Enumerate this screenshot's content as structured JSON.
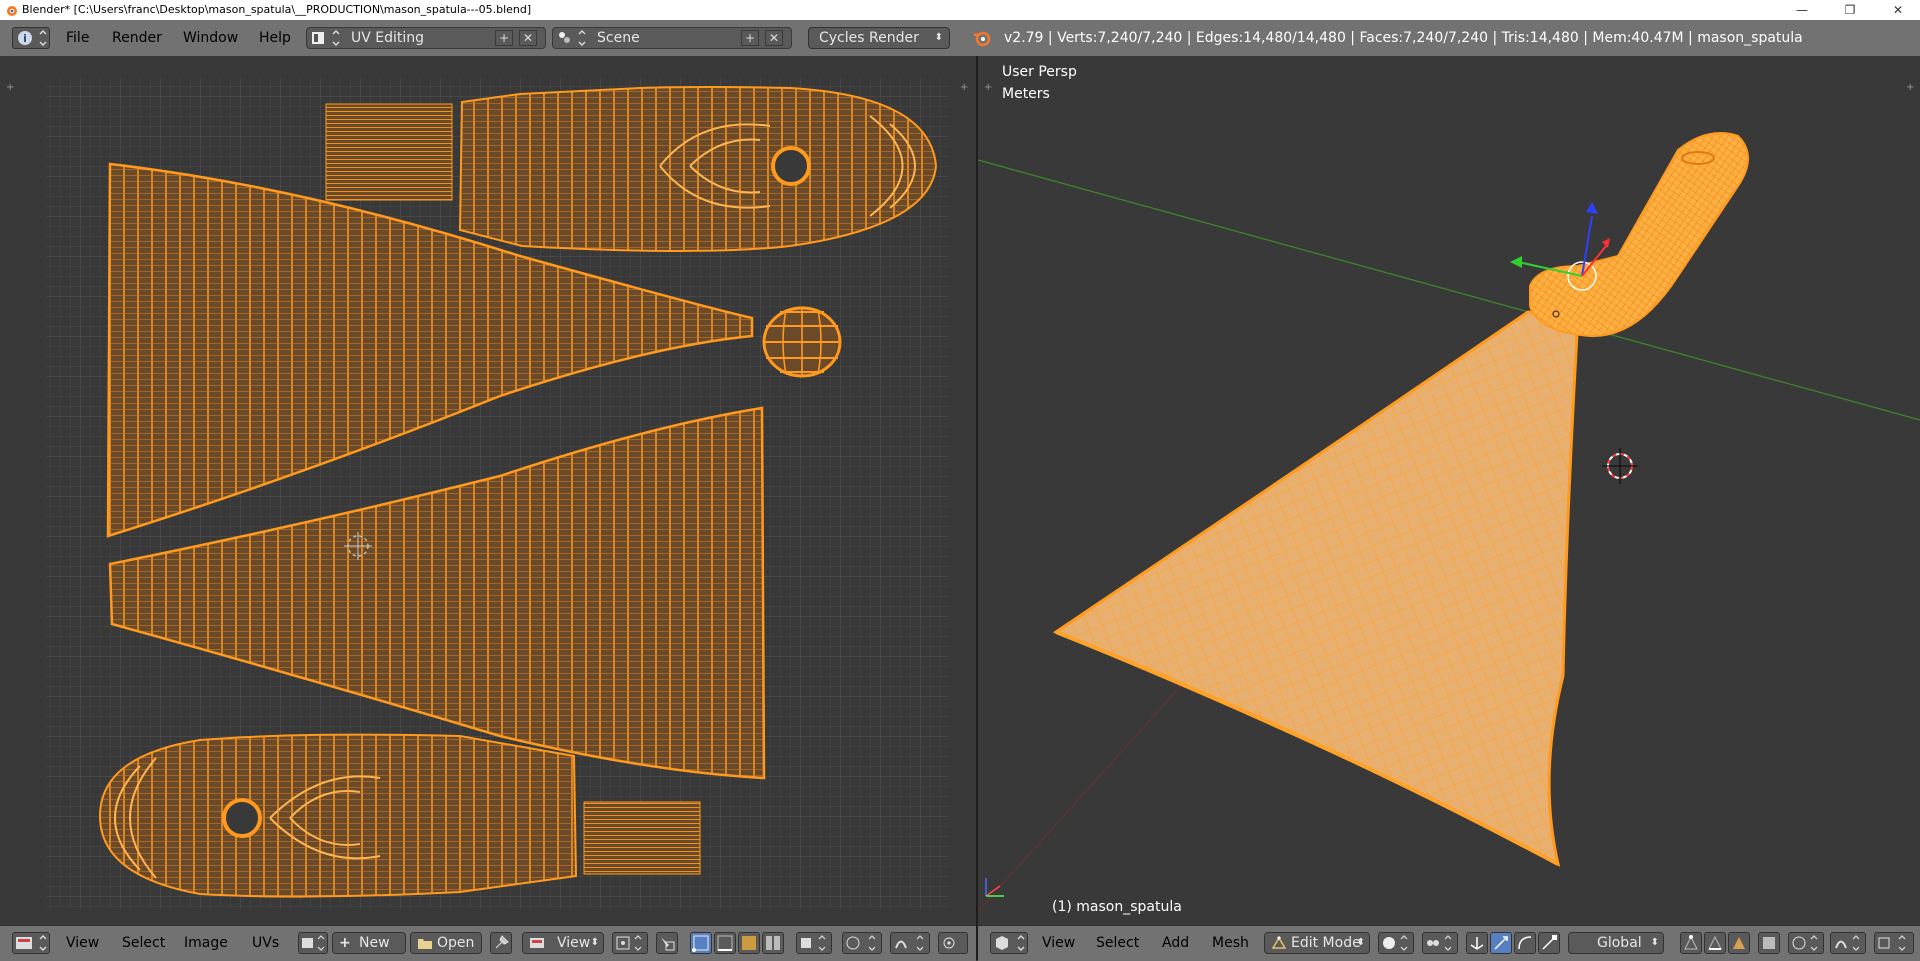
{
  "window": {
    "title": "Blender* [C:\\Users\\franc\\Desktop\\mason_spatula\\__PRODUCTION\\mason_spatula---05.blend]",
    "minimize": "—",
    "maximize": "❐",
    "close": "✕"
  },
  "menu": {
    "file": "File",
    "render": "Render",
    "window": "Window",
    "help": "Help"
  },
  "screen_layout": "UV Editing",
  "scene": "Scene",
  "render_engine": "Cycles Render",
  "info_stats": "v2.79 | Verts:7,240/7,240 | Edges:14,480/14,480 | Faces:7,240/7,240 | Tris:14,480 | Mem:40.47M | mason_spatula",
  "viewport": {
    "view_name": "User Persp",
    "units": "Meters",
    "object_label": "(1) mason_spatula"
  },
  "uv_header": {
    "view": "View",
    "select": "Select",
    "image": "Image",
    "uvs": "UVs",
    "new": "New",
    "open": "Open",
    "view_dropdown": "View"
  },
  "vp_header": {
    "view": "View",
    "select": "Select",
    "add": "Add",
    "mesh": "Mesh",
    "mode": "Edit Mode",
    "orientation": "Global"
  },
  "colors": {
    "mesh_orange": "#ff9a1f",
    "mesh_fill": "#6a4a28",
    "blade_fill": "#e8b070",
    "background": "#393939",
    "header": "#727272"
  }
}
